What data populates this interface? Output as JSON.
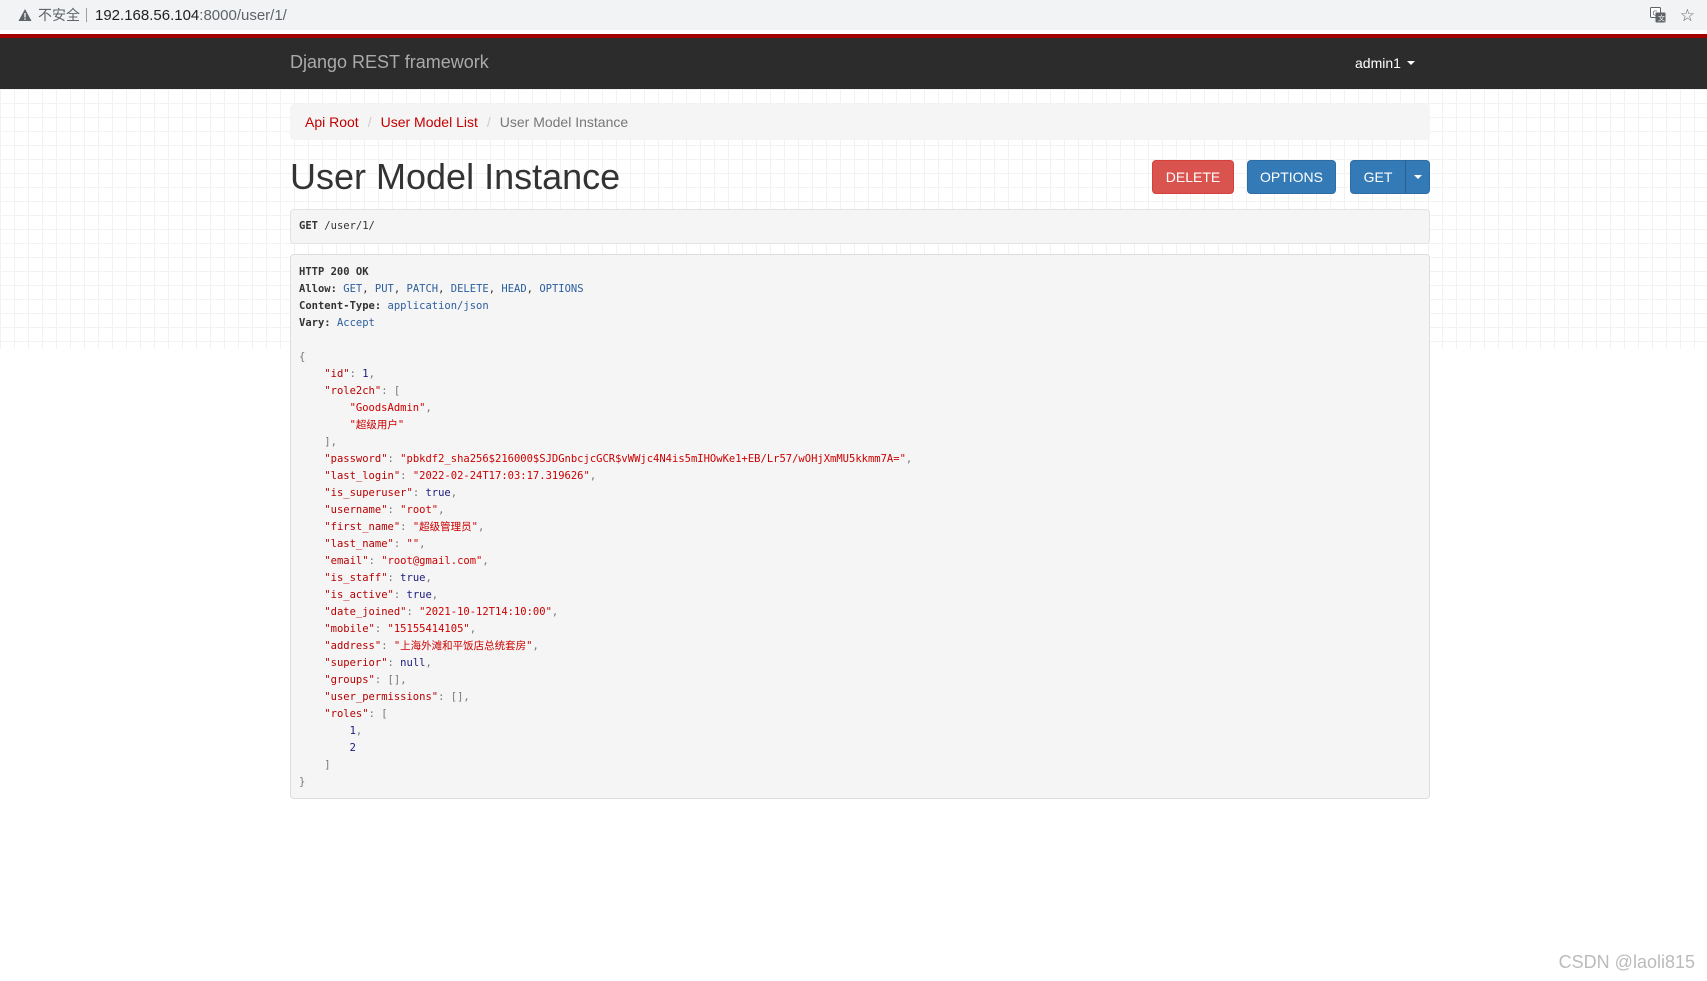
{
  "browser": {
    "security_label": "不安全",
    "url_host": "192.168.56.104",
    "url_path": ":8000/user/1/",
    "icons": [
      "warning-icon",
      "translate-icon",
      "star-icon"
    ]
  },
  "navbar": {
    "brand": "Django REST framework",
    "user": "admin1"
  },
  "breadcrumb": {
    "items": [
      "Api Root",
      "User Model List",
      "User Model Instance"
    ],
    "separator": "/"
  },
  "page": {
    "title": "User Model Instance"
  },
  "buttons": {
    "delete": "DELETE",
    "options": "OPTIONS",
    "get": "GET"
  },
  "request": {
    "method": "GET",
    "path": "/user/1/"
  },
  "response": {
    "status": "HTTP 200 OK",
    "headers": {
      "allow_key": "Allow:",
      "allow_values": [
        "GET",
        "PUT",
        "PATCH",
        "DELETE",
        "HEAD",
        "OPTIONS"
      ],
      "content_type_key": "Content-Type:",
      "content_type": "application/json",
      "vary_key": "Vary:",
      "vary": "Accept"
    },
    "body": {
      "id": "1",
      "role2ch": [
        "\"GoodsAdmin\"",
        "\"超级用户\""
      ],
      "password": "\"pbkdf2_sha256$216000$SJDGnbcjcGCR$vWWjc4N4is5mIHOwKe1+EB/Lr57/wOHjXmMU5kkmm7A=\"",
      "last_login": "\"2022-02-24T17:03:17.319626\"",
      "is_superuser": "true",
      "username": "\"root\"",
      "first_name": "\"超级管理员\"",
      "last_name": "\"\"",
      "email": "\"root@gmail.com\"",
      "is_staff": "true",
      "is_active": "true",
      "date_joined": "\"2021-10-12T14:10:00\"",
      "mobile": "\"15155414105\"",
      "address": "\"上海外滩和平饭店总统套房\"",
      "superior": "null",
      "groups": "[]",
      "user_permissions": "[]",
      "roles": [
        "1",
        "2"
      ]
    }
  },
  "watermark": "CSDN @laoli815",
  "colors": {
    "accent_red": "#c20000",
    "navbar_bg": "#2c2c2c",
    "navbar_border": "#a30000",
    "delete_btn": "#d9534f",
    "primary_btn": "#337ab7"
  }
}
